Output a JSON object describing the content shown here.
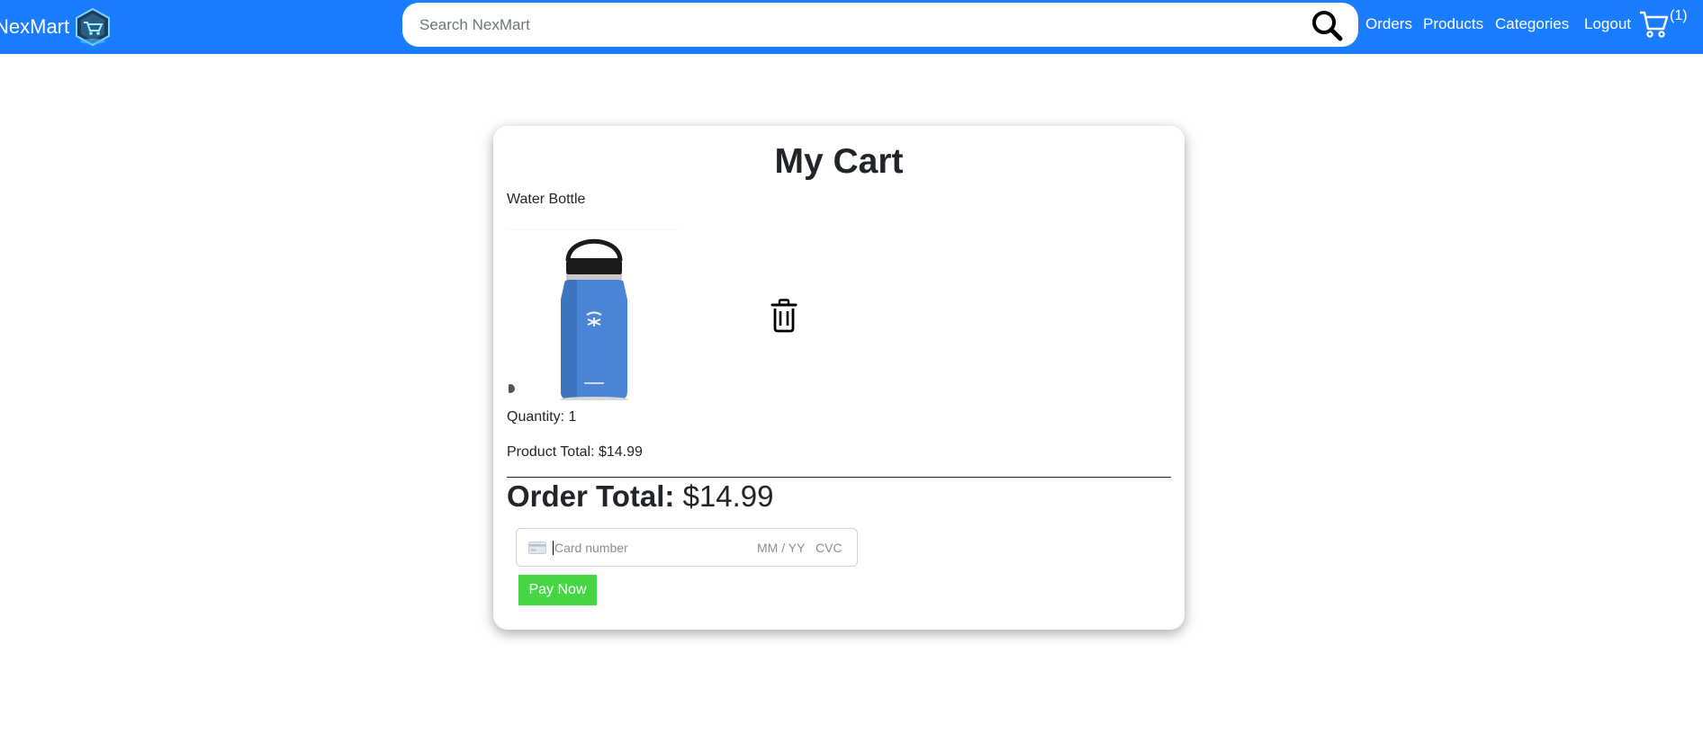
{
  "header": {
    "brand": "NexMart",
    "search_placeholder": "Search NexMart",
    "nav": {
      "orders": "Orders",
      "products": "Products",
      "categories": "Categories",
      "logout": "Logout"
    },
    "cart_count": "(1)"
  },
  "cart": {
    "title": "My Cart",
    "items": [
      {
        "name": "Water Bottle",
        "quantity_text": "Quantity: 1",
        "total_text": "Product Total: $14.99"
      }
    ],
    "order_total_label": "Order Total:",
    "order_total_value": "$14.99"
  },
  "payment": {
    "card_placeholder": "Card number",
    "expiry_placeholder": "MM / YY",
    "cvc_placeholder": "CVC",
    "pay_button": "Pay Now"
  },
  "colors": {
    "header_bg": "#1a7cff",
    "pay_button": "#45d545",
    "bottle_blue": "#4a85d6"
  }
}
